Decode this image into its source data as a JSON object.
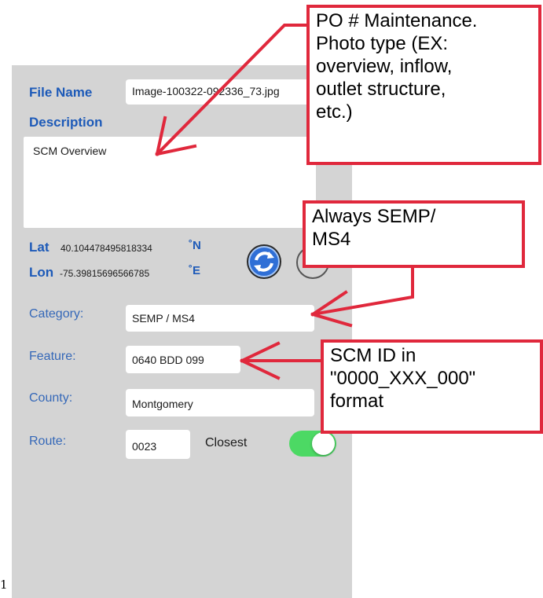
{
  "form": {
    "file_name_label": "File Name",
    "file_name_value": "Image-100322-092336_73.jpg",
    "description_label": "Description",
    "description_value": "SCM Overview",
    "lat_label": "Lat",
    "lat_value": "40.104478495818334",
    "lat_unit": "˚N",
    "lon_label": "Lon",
    "lon_value": "-75.39815696566785",
    "lon_unit": "˚E",
    "category_label": "Category:",
    "category_value": "SEMP / MS4",
    "feature_label": "Feature:",
    "feature_value": "0640 BDD 099",
    "county_label": "County:",
    "county_value": "Montgomery",
    "route_label": "Route:",
    "route_value": "0023",
    "closest_label": "Closest",
    "closest_on": true
  },
  "annotations": {
    "po_callout": [
      "PO # Maintenance.",
      "Photo type (EX:",
      "overview, inflow,",
      "outlet structure,",
      "etc.)"
    ],
    "semp_callout": [
      "Always SEMP/",
      "MS4"
    ],
    "scm_callout": [
      "SCM ID in",
      "\"0000_XXX_000\"",
      "format"
    ]
  },
  "page_stub": "1",
  "colors": {
    "panel": "#d4d4d4",
    "label_blue": "#1d5ab8",
    "callout_red": "#e0283c",
    "toggle_green": "#4cd964"
  },
  "icons": [
    "refresh-icon",
    "circle-button-icon"
  ]
}
